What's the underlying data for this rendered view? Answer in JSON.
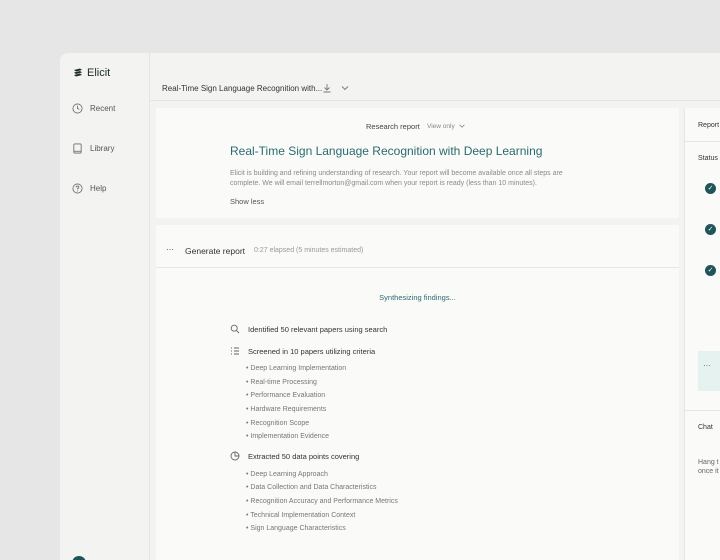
{
  "app": {
    "name": "Elicit"
  },
  "sidebar": {
    "items": [
      {
        "label": "Recent",
        "icon": "clock-icon"
      },
      {
        "label": "Library",
        "icon": "book-icon"
      },
      {
        "label": "Help",
        "icon": "help-icon"
      }
    ]
  },
  "topbar": {
    "doc_title": "Real-Time Sign Language Recognition with..."
  },
  "report": {
    "kind": "Research report",
    "view_mode": "View only",
    "title": "Real-Time Sign Language Recognition with Deep Learning",
    "description": "Elicit is building and refining understanding of research. Your report will become available once all steps are complete. We will email terrellmorton@gmail.com when your report is ready (less than 10 minutes).",
    "show_less": "Show less"
  },
  "generate": {
    "label": "Generate report",
    "elapsed": "0:27 elapsed (5 minutes estimated)",
    "status": "Synthesizing findings..."
  },
  "steps": [
    {
      "text": "Identified 50 relevant papers using search",
      "icon": "search-icon",
      "bullets": []
    },
    {
      "text": "Screened in 10 papers utilizing criteria",
      "icon": "list-icon",
      "bullets": [
        "Deep Learning Implementation",
        "Real-time Processing",
        "Performance Evaluation",
        "Hardware Requirements",
        "Recognition Scope",
        "Implementation Evidence"
      ]
    },
    {
      "text": "Extracted 50 data points covering",
      "icon": "pie-icon",
      "bullets": [
        "Deep Learning Approach",
        "Data Collection and Data Characteristics",
        "Recognition Accuracy and Performance Metrics",
        "Technical Implementation Context",
        "Sign Language Characteristics"
      ]
    }
  ],
  "right_panel": {
    "header": "Report",
    "status_label": "Status",
    "chat_label": "Chat",
    "chat_text_1": "Hang t",
    "chat_text_2": "once it"
  },
  "colors": {
    "accent": "#2a6b6f",
    "dark_teal": "#1f5458"
  }
}
